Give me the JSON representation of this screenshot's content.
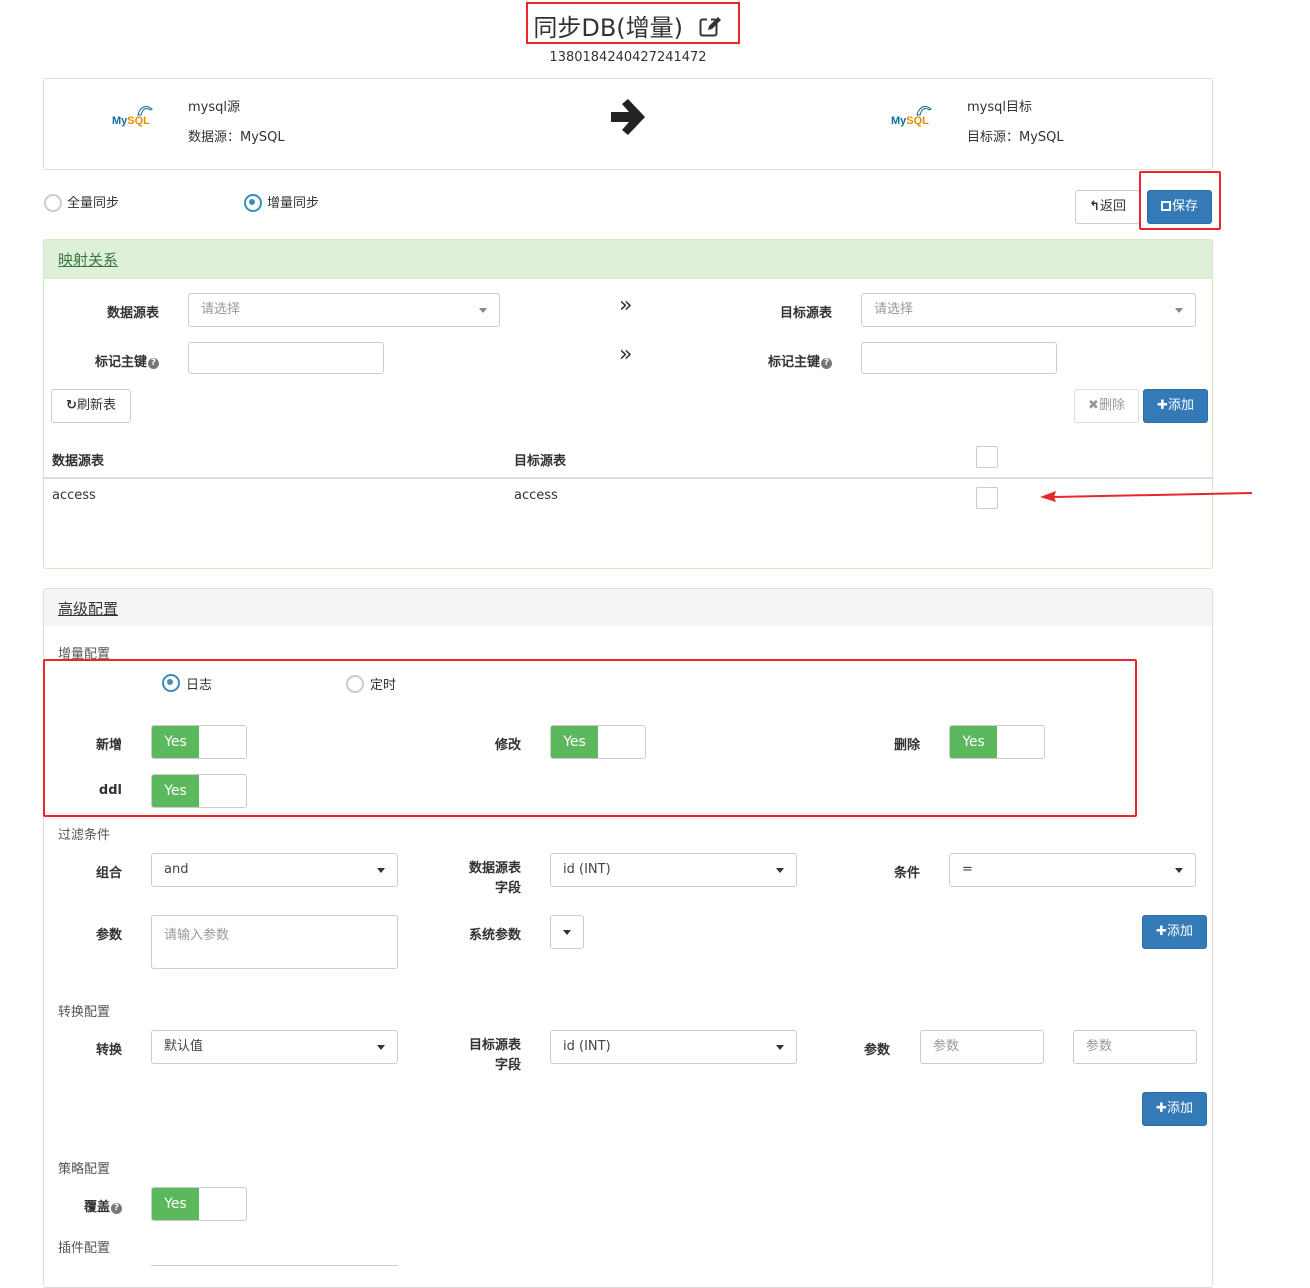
{
  "header": {
    "title": "同步DB(增量)",
    "job_id": "1380184240427241472"
  },
  "source": {
    "logo_text_a": "My",
    "logo_text_b": "SQL",
    "name": "mysql源",
    "type_label": "数据源：MySQL"
  },
  "target": {
    "logo_text_a": "My",
    "logo_text_b": "SQL",
    "name": "mysql目标",
    "type_label": "目标源：MySQL"
  },
  "sync_mode": {
    "full_label": "全量同步",
    "incremental_label": "增量同步",
    "selected": "incremental"
  },
  "actions": {
    "back_label": "返回",
    "save_label": "保存"
  },
  "mapping": {
    "header": "映射关系",
    "source_table_label": "数据源表",
    "source_table_placeholder": "请选择",
    "target_table_label": "目标源表",
    "target_table_placeholder": "请选择",
    "source_pk_label": "标记主键",
    "target_pk_label": "标记主键",
    "refresh_label": "刷新表",
    "delete_label": "删除",
    "add_label": "添加",
    "table": {
      "col_source": "数据源表",
      "col_target": "目标源表",
      "rows": [
        {
          "source": "access",
          "target": "access"
        }
      ]
    }
  },
  "advanced": {
    "header": "高级配置",
    "incremental_section": "增量配置",
    "mode_log": "日志",
    "mode_timer": "定时",
    "selected_mode": "log",
    "toggles": {
      "insert_label": "新增",
      "update_label": "修改",
      "delete_label": "删除",
      "ddl_label": "ddl",
      "yes": "Yes"
    },
    "filter": {
      "section": "过滤条件",
      "combine_label": "组合",
      "combine_value": "and",
      "field_label_1": "数据源表",
      "field_label_2": "字段",
      "field_value": "id (INT)",
      "condition_label": "条件",
      "condition_value": "=",
      "param_label": "参数",
      "param_placeholder": "请输入参数",
      "sys_param_label": "系统参数",
      "add_label": "添加"
    },
    "convert": {
      "section": "转换配置",
      "convert_label": "转换",
      "convert_value": "默认值",
      "field_label_1": "目标源表",
      "field_label_2": "字段",
      "field_value": "id (INT)",
      "param_label": "参数",
      "param_placeholder_1": "参数",
      "param_placeholder_2": "参数",
      "add_label": "添加"
    },
    "strategy": {
      "section": "策略配置",
      "overwrite_label": "覆盖",
      "yes": "Yes"
    },
    "plugin": {
      "section": "插件配置"
    }
  }
}
